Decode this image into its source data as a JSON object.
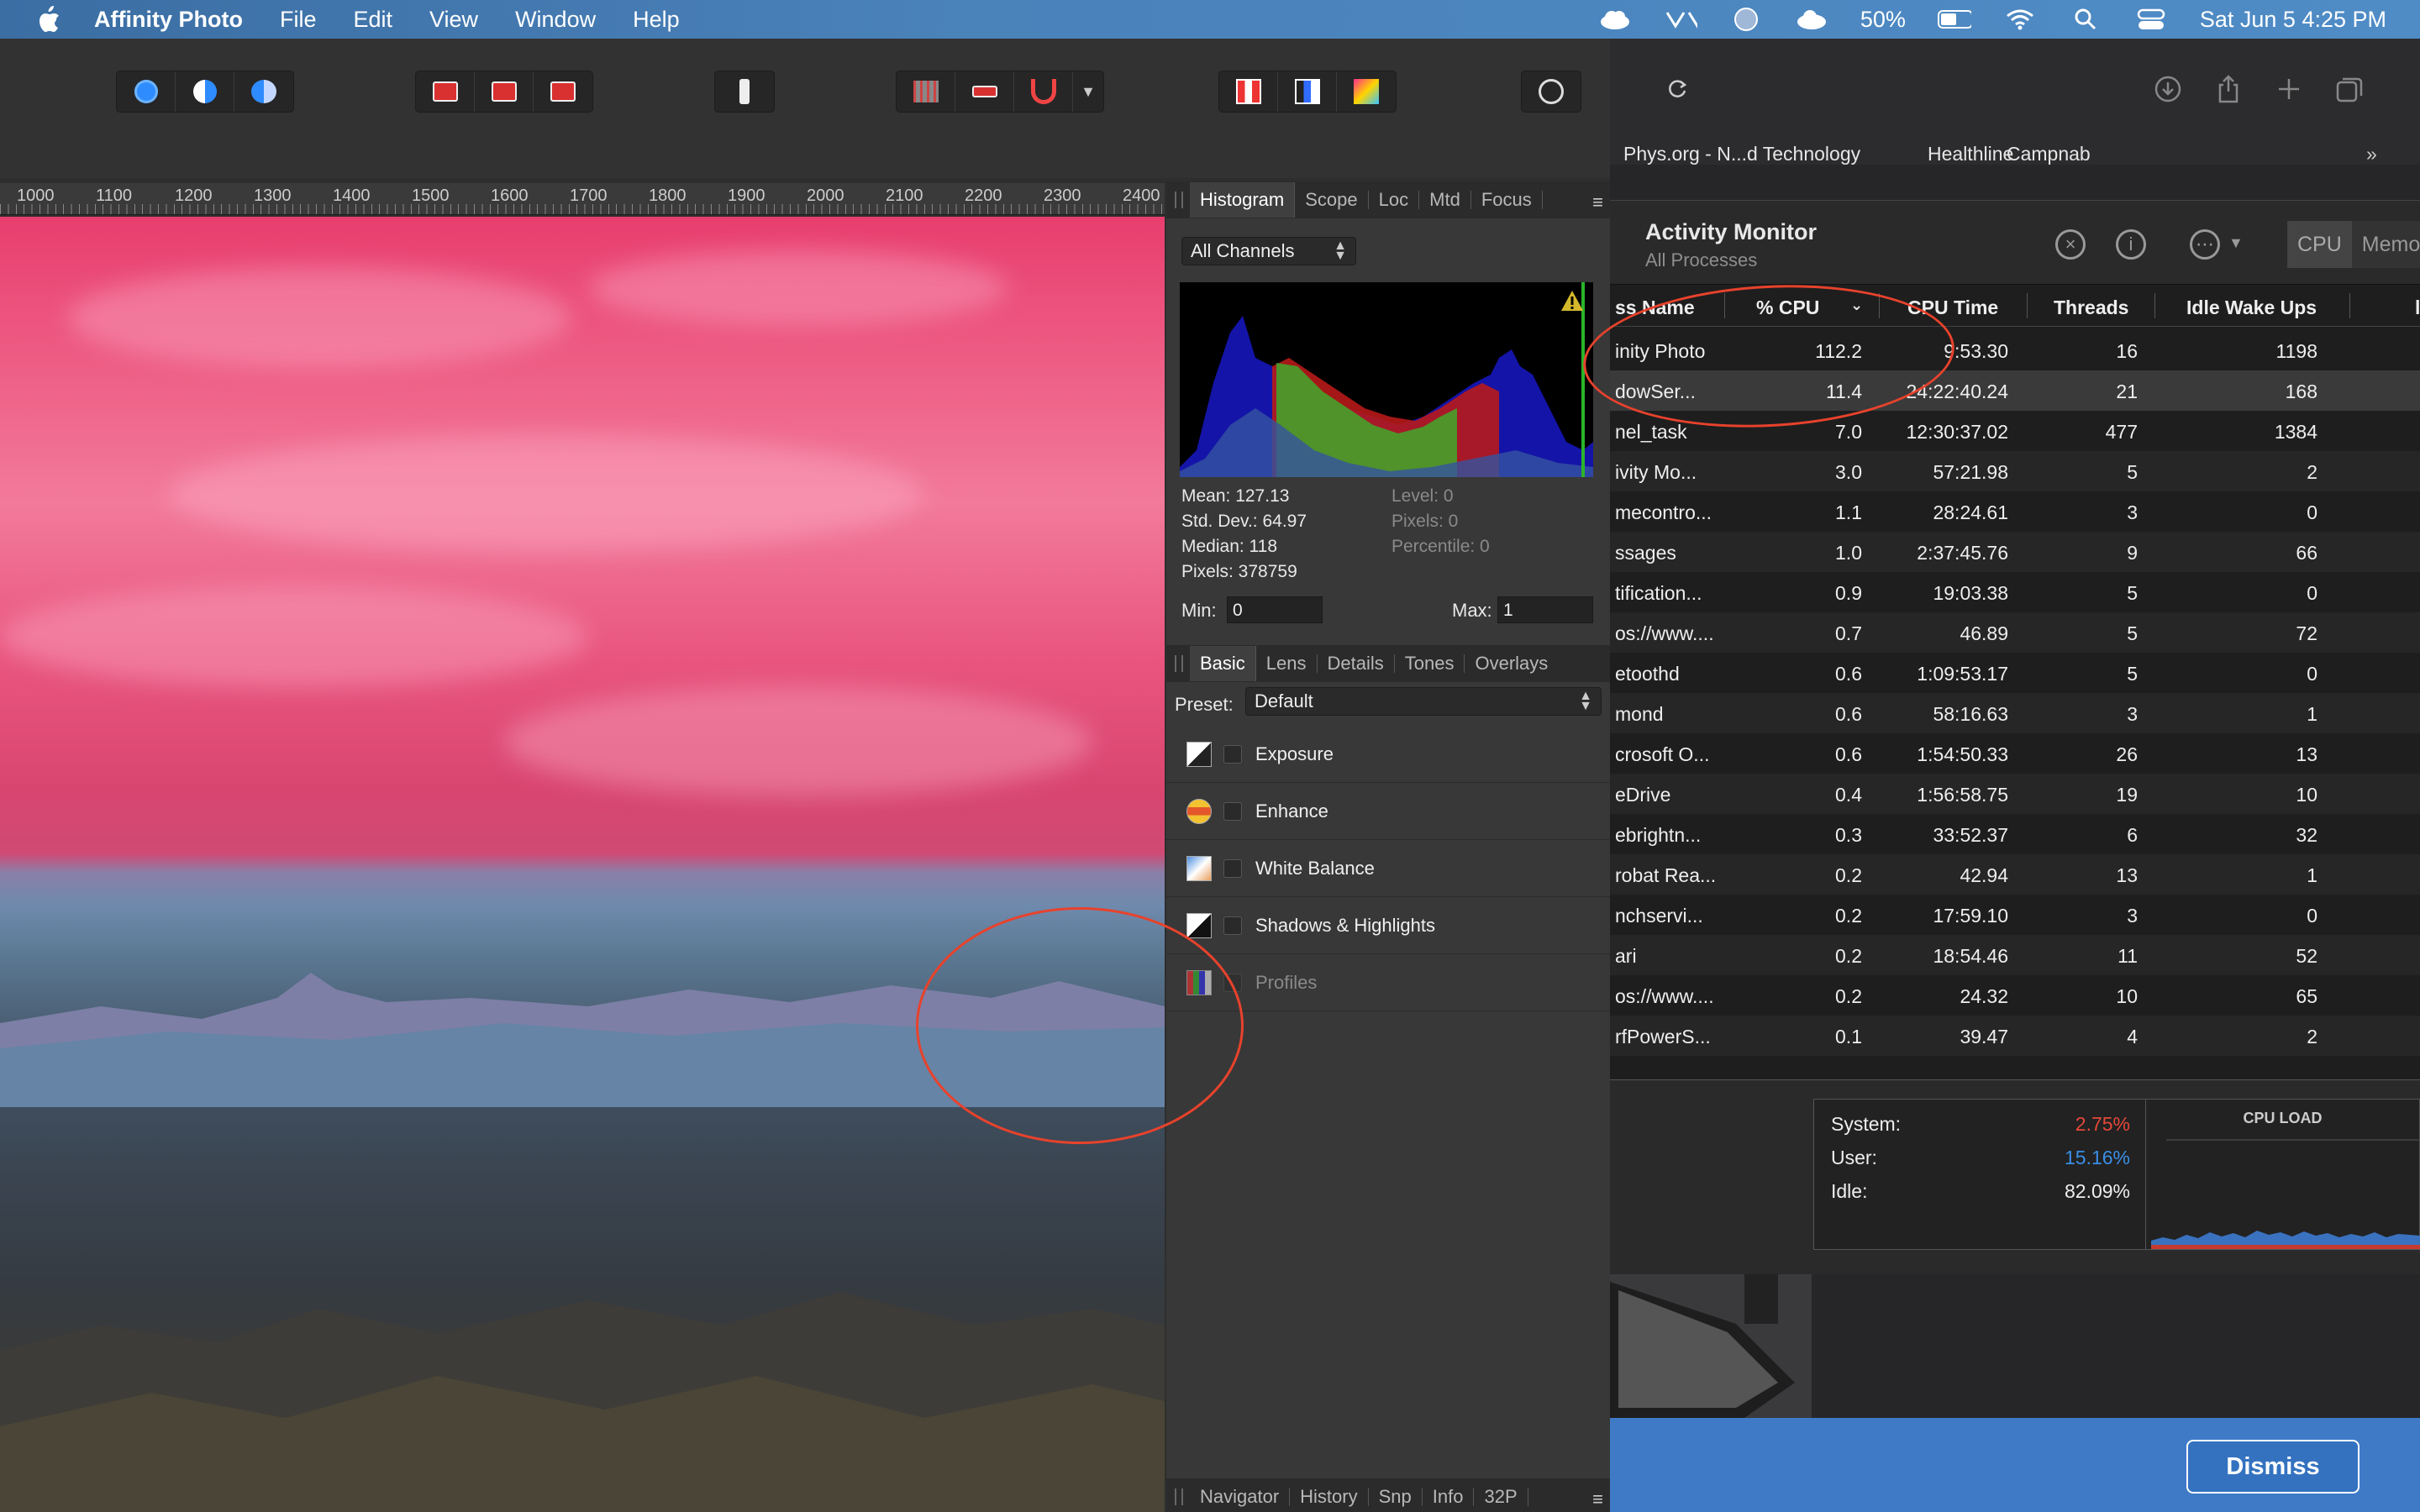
{
  "menubar": {
    "app_name": "Affinity Photo",
    "menus": [
      "File",
      "Edit",
      "View",
      "Window",
      "Help"
    ],
    "battery": "50%",
    "datetime": "Sat Jun 5  4:25 PM"
  },
  "ruler": {
    "labels": [
      "1000",
      "1100",
      "1200",
      "1300",
      "1400",
      "1500",
      "1600",
      "1700",
      "1800",
      "1900",
      "2000",
      "2100",
      "2200",
      "2300",
      "2400"
    ]
  },
  "histogram_panel": {
    "tabs": [
      "Histogram",
      "Scope",
      "Loc",
      "Mtd",
      "Focus"
    ],
    "channel": "All Channels",
    "mean": "Mean: 127.13",
    "stddev": "Std. Dev.: 64.97",
    "median": "Median: 118",
    "pixels": "Pixels: 378759",
    "level": "Level: 0",
    "pixels_sel": "Pixels: 0",
    "percentile": "Percentile: 0",
    "min_label": "Min:",
    "min_value": "0",
    "max_label": "Max:",
    "max_value": "1"
  },
  "develop_panel": {
    "tabs": [
      "Basic",
      "Lens",
      "Details",
      "Tones",
      "Overlays"
    ],
    "preset_label": "Preset:",
    "preset_value": "Default",
    "items": [
      "Exposure",
      "Enhance",
      "White Balance",
      "Shadows & Highlights",
      "Profiles"
    ]
  },
  "bottom_panel": {
    "tabs": [
      "Navigator",
      "History",
      "Snp",
      "Info",
      "32P"
    ]
  },
  "safari": {
    "favorites": [
      "Phys.org - N...d Technology",
      "Healthline",
      "Campnab"
    ]
  },
  "activity_monitor": {
    "title": "Activity Monitor",
    "subtitle": "All Processes",
    "segments": [
      "CPU",
      "Memo"
    ],
    "columns": {
      "name": "ss Name",
      "cpu": "% CPU",
      "cpu_time": "CPU Time",
      "threads": "Threads",
      "idle": "Idle Wake Ups"
    },
    "rows": [
      {
        "name": "inity Photo",
        "cpu": "112.2",
        "time": "9:53.30",
        "threads": "16",
        "idle": "1198"
      },
      {
        "name": "dowSer...",
        "cpu": "11.4",
        "time": "24:22:40.24",
        "threads": "21",
        "idle": "168"
      },
      {
        "name": "nel_task",
        "cpu": "7.0",
        "time": "12:30:37.02",
        "threads": "477",
        "idle": "1384"
      },
      {
        "name": "ivity Mo...",
        "cpu": "3.0",
        "time": "57:21.98",
        "threads": "5",
        "idle": "2"
      },
      {
        "name": "mecontro...",
        "cpu": "1.1",
        "time": "28:24.61",
        "threads": "3",
        "idle": "0"
      },
      {
        "name": "ssages",
        "cpu": "1.0",
        "time": "2:37:45.76",
        "threads": "9",
        "idle": "66"
      },
      {
        "name": "tification...",
        "cpu": "0.9",
        "time": "19:03.38",
        "threads": "5",
        "idle": "0"
      },
      {
        "name": "os://www....",
        "cpu": "0.7",
        "time": "46.89",
        "threads": "5",
        "idle": "72"
      },
      {
        "name": "etoothd",
        "cpu": "0.6",
        "time": "1:09:53.17",
        "threads": "5",
        "idle": "0"
      },
      {
        "name": "mond",
        "cpu": "0.6",
        "time": "58:16.63",
        "threads": "3",
        "idle": "1"
      },
      {
        "name": "crosoft O...",
        "cpu": "0.6",
        "time": "1:54:50.33",
        "threads": "26",
        "idle": "13"
      },
      {
        "name": "eDrive",
        "cpu": "0.4",
        "time": "1:56:58.75",
        "threads": "19",
        "idle": "10"
      },
      {
        "name": "ebrightn...",
        "cpu": "0.3",
        "time": "33:52.37",
        "threads": "6",
        "idle": "32"
      },
      {
        "name": "robat Rea...",
        "cpu": "0.2",
        "time": "42.94",
        "threads": "13",
        "idle": "1"
      },
      {
        "name": "nchservi...",
        "cpu": "0.2",
        "time": "17:59.10",
        "threads": "3",
        "idle": "0"
      },
      {
        "name": "ari",
        "cpu": "0.2",
        "time": "18:54.46",
        "threads": "11",
        "idle": "52"
      },
      {
        "name": "os://www....",
        "cpu": "0.2",
        "time": "24.32",
        "threads": "10",
        "idle": "65"
      },
      {
        "name": "rfPowerS...",
        "cpu": "0.1",
        "time": "39.47",
        "threads": "4",
        "idle": "2"
      }
    ],
    "stats": {
      "system_label": "System:",
      "system_value": "2.75%",
      "user_label": "User:",
      "user_value": "15.16%",
      "idle_label": "Idle:",
      "idle_value": "82.09%"
    },
    "graph_title": "CPU LOAD"
  },
  "banner": {
    "dismiss": "Dismiss"
  },
  "colors": {
    "accent_blue": "#2f8cff",
    "system_red": "#e5473a",
    "user_blue": "#3a8ee6",
    "annotation_red": "#e8422c"
  }
}
